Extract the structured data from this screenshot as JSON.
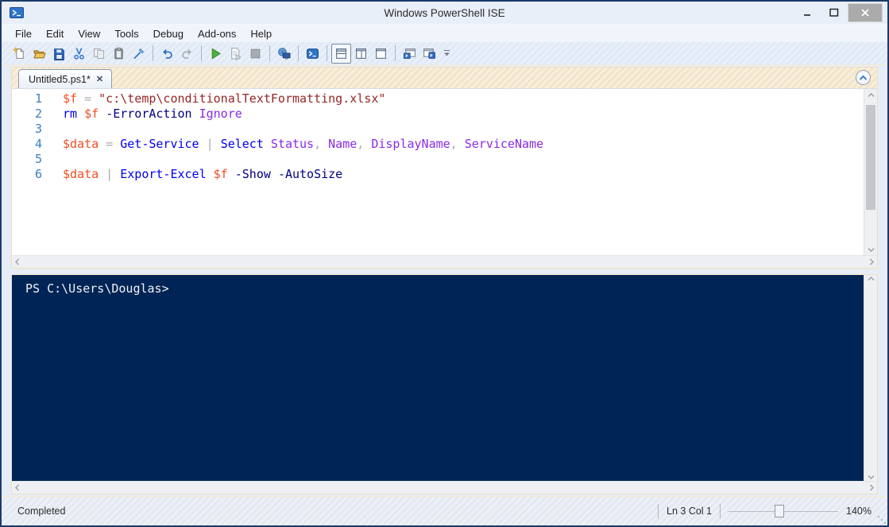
{
  "window": {
    "title": "Windows PowerShell ISE"
  },
  "window_controls": {
    "buttons": [
      "minimize",
      "maximize",
      "close"
    ]
  },
  "menu": {
    "items": [
      "File",
      "Edit",
      "View",
      "Tools",
      "Debug",
      "Add-ons",
      "Help"
    ]
  },
  "toolbar": {
    "buttons": [
      "new-script",
      "open-script",
      "save",
      "cut",
      "copy",
      "paste",
      "clear-console-pane",
      "undo",
      "redo",
      "run-script",
      "run-selection",
      "stop-operation",
      "new-remote-powershell-tab",
      "start-powershell-exe",
      "show-script-pane-top",
      "show-script-pane-right",
      "show-script-pane-maximized",
      "new-powershell-tab",
      "open-in-new-window",
      "toolbar-overflow"
    ],
    "selected_layout": "show-script-pane-top"
  },
  "tab": {
    "label": "Untitled5.ps1*",
    "close_glyph": "✕"
  },
  "editor": {
    "lines": [
      {
        "num": "1",
        "tokens": [
          {
            "c": "var",
            "t": "$f"
          },
          {
            "c": "op",
            "t": " = "
          },
          {
            "c": "str",
            "t": "\"c:\\temp\\conditionalTextFormatting.xlsx\""
          }
        ]
      },
      {
        "num": "2",
        "tokens": [
          {
            "c": "cmd",
            "t": "rm"
          },
          {
            "c": "plain",
            "t": " "
          },
          {
            "c": "var",
            "t": "$f"
          },
          {
            "c": "plain",
            "t": " "
          },
          {
            "c": "param",
            "t": "-ErrorAction"
          },
          {
            "c": "plain",
            "t": " "
          },
          {
            "c": "arg",
            "t": "Ignore"
          }
        ]
      },
      {
        "num": "3",
        "tokens": []
      },
      {
        "num": "4",
        "tokens": [
          {
            "c": "var",
            "t": "$data"
          },
          {
            "c": "op",
            "t": " = "
          },
          {
            "c": "cmd",
            "t": "Get-Service"
          },
          {
            "c": "op",
            "t": " | "
          },
          {
            "c": "cmd",
            "t": "Select"
          },
          {
            "c": "plain",
            "t": " "
          },
          {
            "c": "arg",
            "t": "Status"
          },
          {
            "c": "op",
            "t": ", "
          },
          {
            "c": "arg",
            "t": "Name"
          },
          {
            "c": "op",
            "t": ", "
          },
          {
            "c": "arg",
            "t": "DisplayName"
          },
          {
            "c": "op",
            "t": ", "
          },
          {
            "c": "arg",
            "t": "ServiceName"
          }
        ]
      },
      {
        "num": "5",
        "tokens": []
      },
      {
        "num": "6",
        "tokens": [
          {
            "c": "var",
            "t": "$data"
          },
          {
            "c": "op",
            "t": " | "
          },
          {
            "c": "cmd",
            "t": "Export-Excel"
          },
          {
            "c": "plain",
            "t": " "
          },
          {
            "c": "var",
            "t": "$f"
          },
          {
            "c": "plain",
            "t": " "
          },
          {
            "c": "param",
            "t": "-Show"
          },
          {
            "c": "plain",
            "t": " "
          },
          {
            "c": "param",
            "t": "-AutoSize"
          }
        ]
      }
    ]
  },
  "console": {
    "prompt": "PS C:\\Users\\Douglas>"
  },
  "statusbar": {
    "status": "Completed",
    "position": "Ln 3 Col 1",
    "zoom_level": "140%"
  },
  "colors": {
    "console_background": "#012456",
    "console_text": "#f2f2f2",
    "window_border": "#1b3a6b",
    "accent_cream": "#f1e4c9",
    "syntax_variable": "#f04e23",
    "syntax_command": "#0000ee",
    "syntax_string": "#992525",
    "syntax_parameter": "#000080",
    "syntax_argument": "#8a2be2",
    "syntax_operator": "#a9a9a9",
    "line_number": "#3b7dbf"
  }
}
